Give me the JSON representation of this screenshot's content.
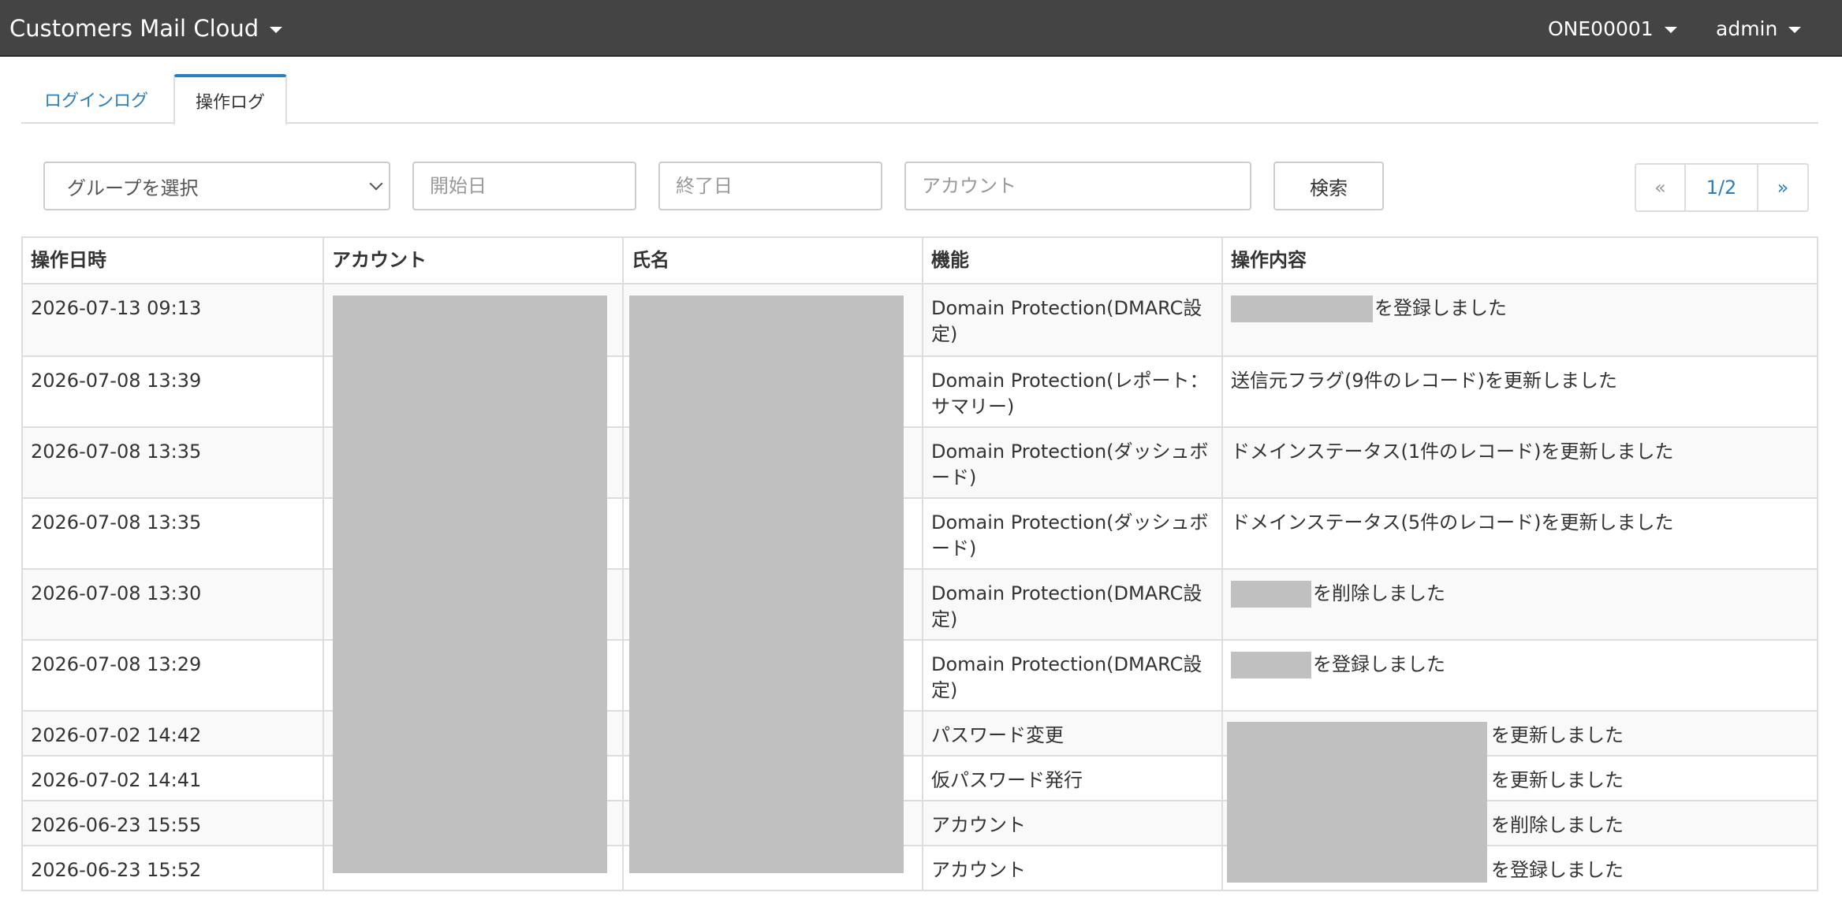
{
  "navbar": {
    "brand": "Customers Mail Cloud",
    "tenant": "ONE00001",
    "user": "admin"
  },
  "tabs": [
    {
      "label": "ログインログ",
      "active": false
    },
    {
      "label": "操作ログ",
      "active": true
    }
  ],
  "filters": {
    "group_placeholder": "グループを選択",
    "start_placeholder": "開始日",
    "end_placeholder": "終了日",
    "account_placeholder": "アカウント",
    "search_label": "検索"
  },
  "pagination": {
    "prev": "«",
    "current": "1/2",
    "next": "»"
  },
  "table": {
    "headers": [
      "操作日時",
      "アカウント",
      "氏名",
      "機能",
      "操作内容"
    ],
    "rows": [
      {
        "datetime": "2026-07-13 09:13",
        "function": "Domain Protection(DMARC設定)",
        "content": "を登録しました"
      },
      {
        "datetime": "2026-07-08 13:39",
        "function": "Domain Protection(レポート：サマリー)",
        "content": "送信元フラグ(9件のレコード)を更新しました"
      },
      {
        "datetime": "2026-07-08 13:35",
        "function": "Domain Protection(ダッシュボード)",
        "content": "ドメインステータス(1件のレコード)を更新しました"
      },
      {
        "datetime": "2026-07-08 13:35",
        "function": "Domain Protection(ダッシュボード)",
        "content": "ドメインステータス(5件のレコード)を更新しました"
      },
      {
        "datetime": "2026-07-08 13:30",
        "function": "Domain Protection(DMARC設定)",
        "content": "を削除しました"
      },
      {
        "datetime": "2026-07-08 13:29",
        "function": "Domain Protection(DMARC設定)",
        "content": "を登録しました"
      },
      {
        "datetime": "2026-07-02 14:42",
        "function": "パスワード変更",
        "content": "を更新しました"
      },
      {
        "datetime": "2026-07-02 14:41",
        "function": "仮パスワード発行",
        "content": "を更新しました"
      },
      {
        "datetime": "2026-06-23 15:55",
        "function": "アカウント",
        "content": "を削除しました"
      },
      {
        "datetime": "2026-06-23 15:52",
        "function": "アカウント",
        "content": "を登録しました"
      }
    ]
  },
  "colors": {
    "navbar": "#444444",
    "link": "#2a7fc1",
    "redaction": "#c0c0c0"
  }
}
